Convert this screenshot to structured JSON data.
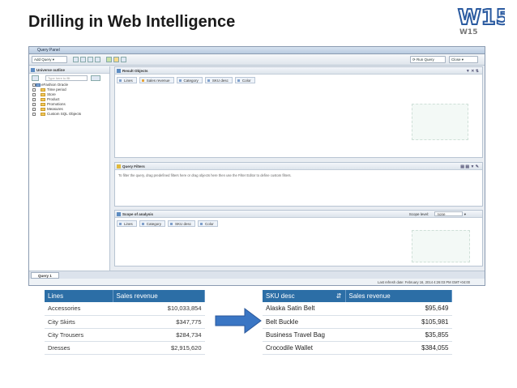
{
  "slide": {
    "title": "Drilling in Web Intelligence",
    "logo_text": "W15"
  },
  "panel": {
    "window_title": "Query Panel",
    "toolbar": {
      "add_query": "Add Query",
      "run_query": "Run Query",
      "close": "Close"
    },
    "universe": {
      "header": "Universe outline",
      "search_placeholder": "Type here to filt",
      "tree": [
        {
          "label": "eFashion Oracle",
          "root": true
        },
        {
          "label": "Time period"
        },
        {
          "label": "Store"
        },
        {
          "label": "Product"
        },
        {
          "label": "Promotions"
        },
        {
          "label": "Measures"
        },
        {
          "label": "Custom SQL Objects"
        }
      ]
    },
    "result_objects": {
      "header": "Result Objects",
      "chips": [
        {
          "label": "Lines",
          "type": "dimension"
        },
        {
          "label": "Sales revenue",
          "type": "measure"
        },
        {
          "label": "Category",
          "type": "dimension"
        },
        {
          "label": "SKU desc",
          "type": "dimension"
        },
        {
          "label": "Color",
          "type": "dimension"
        }
      ]
    },
    "query_filters": {
      "header": "Query Filters",
      "hint": "To filter the query, drag predefined filters here or drag objects here then use the Filter Editor to define custom filters."
    },
    "scope": {
      "header": "Scope of analysis",
      "level_label": "Scope level:",
      "level_value": "none",
      "chips": [
        "Lines",
        "Category",
        "SKU desc",
        "Color"
      ]
    },
    "query_tab": "Query 1",
    "status": "Last refresh date: February 16, 2014 4:26:03 PM GMT+04:00"
  },
  "table_left": {
    "headers": [
      "Lines",
      "Sales revenue"
    ],
    "rows": [
      [
        "Accessories",
        "$10,033,854"
      ],
      [
        "City Skirts",
        "$347,775"
      ],
      [
        "City Trousers",
        "$284,734"
      ],
      [
        "Dresses",
        "$2,915,620"
      ]
    ]
  },
  "table_right": {
    "headers": [
      "SKU desc",
      "Sales revenue"
    ],
    "rows": [
      [
        "Alaska Satin Belt",
        "$95,649"
      ],
      [
        "Belt Buckle",
        "$105,981"
      ],
      [
        "Business Travel  Bag",
        "$35,855"
      ],
      [
        "Crocodile Wallet",
        "$384,055"
      ]
    ]
  },
  "colors": {
    "table_header": "#2c6ea6",
    "arrow_fill": "#3a76c4",
    "logo_stroke": "#2a5aa0"
  }
}
